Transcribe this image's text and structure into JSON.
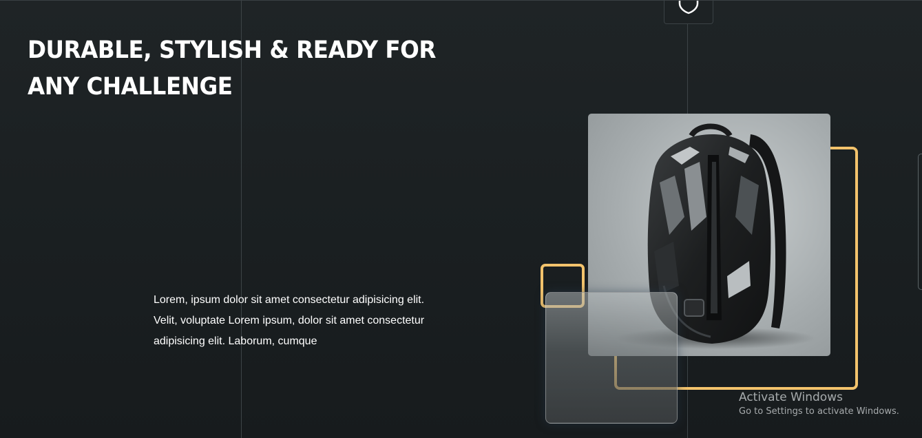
{
  "hero": {
    "headline_line1": "DURABLE, STYLISH & READY FOR",
    "headline_line2": "ANY CHALLENGE",
    "description": "Lorem, ipsum dolor sit amet consectetur adipisicing elit. Velit, voluptate Lorem ipsum, dolor sit amet consectetur adipisicing elit. Laborum, cumque"
  },
  "top_tab": {
    "icon": "shield-icon"
  },
  "product_image": {
    "icon": "backpack-image"
  },
  "colors": {
    "background": "#1c2123",
    "accent": "#f3c36c",
    "text": "#ffffff"
  },
  "watermark": {
    "title": "Activate Windows",
    "subtitle": "Go to Settings to activate Windows."
  }
}
